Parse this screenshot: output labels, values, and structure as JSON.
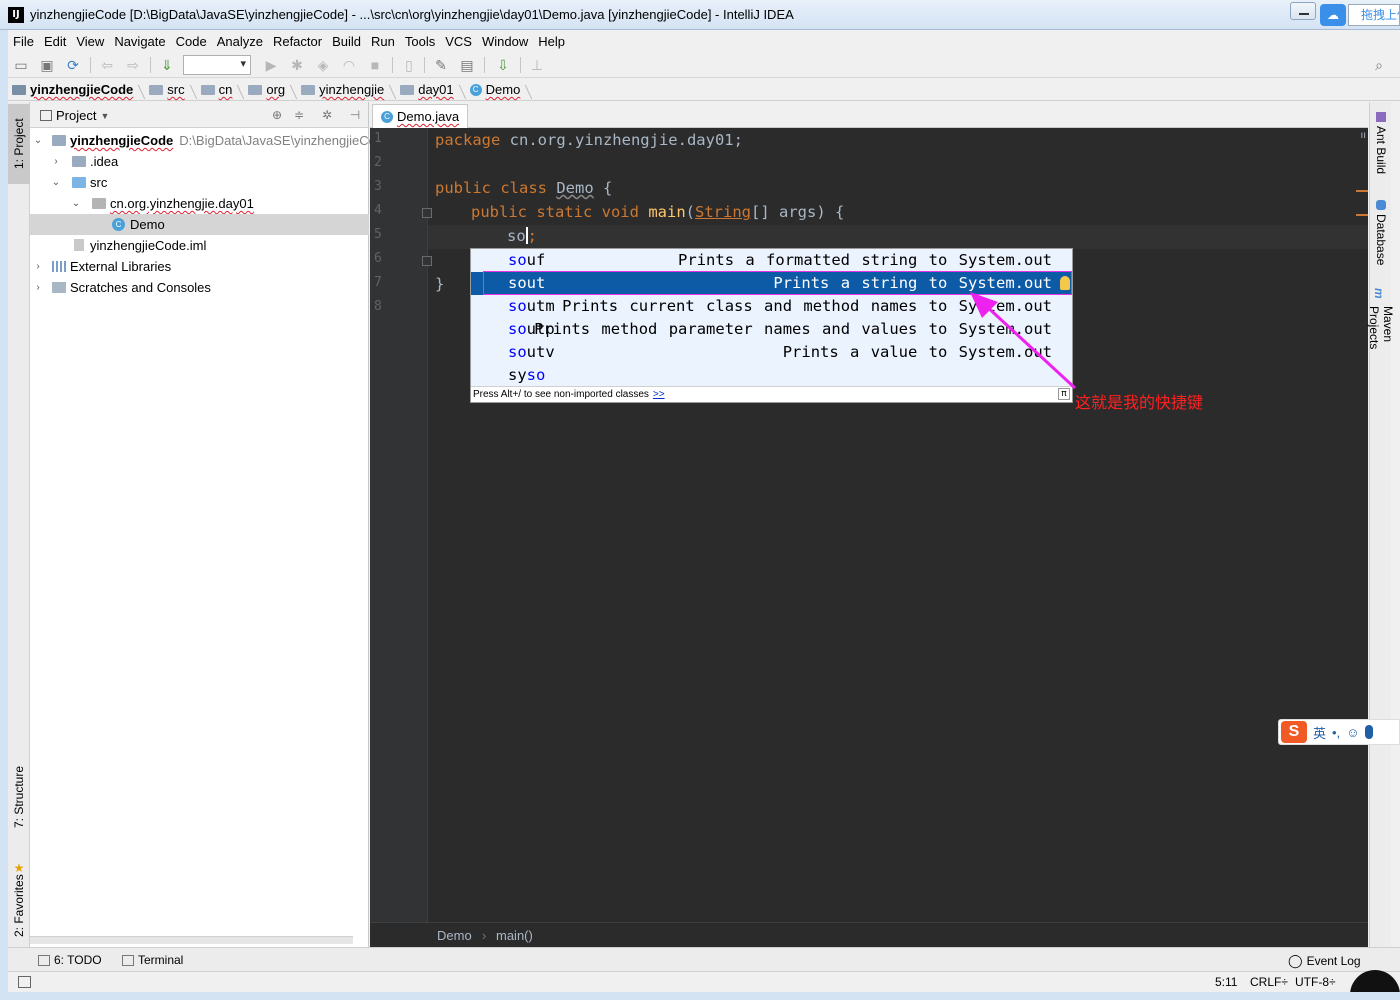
{
  "window": {
    "title": "yinzhengjieCode [D:\\BigData\\JavaSE\\yinzhengjieCode] - ...\\src\\cn\\org\\yinzhengjie\\day01\\Demo.java [yinzhengjieCode] - IntelliJ IDEA",
    "app_icon": "IJ",
    "drag_upload": "拖拽上传"
  },
  "menu": [
    "File",
    "Edit",
    "View",
    "Navigate",
    "Code",
    "Analyze",
    "Refactor",
    "Build",
    "Run",
    "Tools",
    "VCS",
    "Window",
    "Help"
  ],
  "breadcrumb": [
    "yinzhengjieCode",
    "src",
    "cn",
    "org",
    "yinzhengjie",
    "day01",
    "Demo"
  ],
  "left_strip": {
    "project": "1: Project",
    "structure": "7: Structure",
    "favorites": "2: Favorites"
  },
  "project_panel": {
    "title": "Project",
    "tree": [
      {
        "label": "yinzhengjieCode",
        "path": "D:\\BigData\\JavaSE\\yinzhengjieCo",
        "icon": "project-folder-icon"
      },
      {
        "label": ".idea",
        "icon": "folder-icon"
      },
      {
        "label": "src",
        "icon": "source-folder-icon"
      },
      {
        "label": "cn.org.yinzhengjie.day01",
        "icon": "package-icon"
      },
      {
        "label": "Demo",
        "icon": "class-icon"
      },
      {
        "label": "yinzhengjieCode.iml",
        "icon": "iml-file-icon"
      },
      {
        "label": "External Libraries",
        "icon": "libraries-icon"
      },
      {
        "label": "Scratches and Consoles",
        "icon": "scratches-icon"
      }
    ]
  },
  "editor": {
    "tab": "Demo.java",
    "line_numbers": [
      "1",
      "2",
      "3",
      "4",
      "5",
      "6",
      "7",
      "8"
    ],
    "code": {
      "l1_kw": "package",
      "l1_rest": " cn.org.yinzhengjie.day01;",
      "l3_kw": "public class",
      "l3_name": "Demo",
      "l3_rest": " {",
      "l4_kw": "public static void",
      "l4_fn": "main",
      "l4_open": "(",
      "l4_type": "String",
      "l4_rest": "[] args) {",
      "l5_typed": "so",
      "l5_rest": ";",
      "l7": "}"
    },
    "footer": {
      "class": "Demo",
      "method": "main()"
    }
  },
  "completion": {
    "items": [
      {
        "match": "so",
        "rest": "uf",
        "desc": "Prints a formatted string to System.out"
      },
      {
        "match": "so",
        "rest": "ut",
        "desc": "Prints a string to System.out",
        "selected": true
      },
      {
        "match": "so",
        "rest": "utm",
        "desc": "Prints current class and method names to System.out"
      },
      {
        "match": "so",
        "rest": "utp",
        "desc": "Prints method parameter names and values to System.out"
      },
      {
        "match": "so",
        "rest": "utv",
        "desc": "Prints a value to System.out"
      },
      {
        "match": "so",
        "prefix": "sy",
        "desc": ""
      }
    ],
    "footer_text": "Press Alt+/ to see non-imported classes",
    "footer_link": ">>",
    "pi_icon": "π"
  },
  "annotation": {
    "text": "这就是我的快捷键",
    "color": "#ff2020",
    "arrow_color": "#ee22ee"
  },
  "right_strip": {
    "ant": "Ant Build",
    "database": "Database",
    "maven": "Maven Projects"
  },
  "ime": {
    "logo": "S",
    "lang": "英",
    "punct": "•,",
    "emoji": "☺",
    "mic": "🎤"
  },
  "bottom_tools": {
    "todo": "6: TODO",
    "terminal": "Terminal",
    "event_log": "Event Log"
  },
  "status": {
    "position": "5:11",
    "line_sep": "CRLF÷",
    "encoding": "UTF-8÷"
  },
  "colors": {
    "editor_bg": "#2b2b2b",
    "keyword": "#cc7832",
    "function": "#ffc66d",
    "selection": "#0d5aa7"
  }
}
